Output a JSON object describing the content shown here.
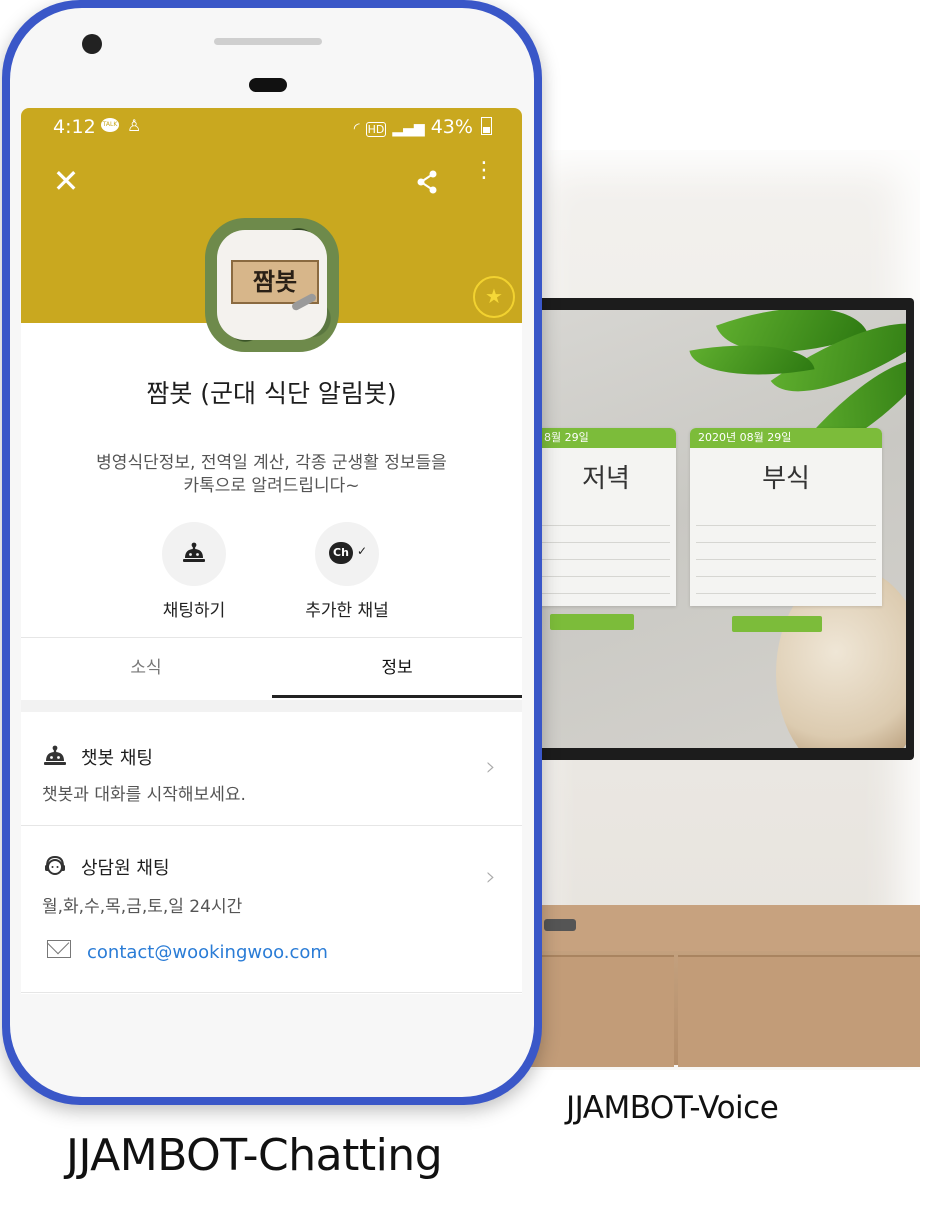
{
  "phone": {
    "status_bar": {
      "time": "4:12",
      "talk_badge": "TALK",
      "network": "HD",
      "battery": "43%"
    },
    "header": {
      "close_icon": "close-icon",
      "share_icon": "share-icon",
      "more_icon": "more-vert-icon",
      "hero_color": "#c9a81f"
    },
    "profile": {
      "avatar_text": "짬봇",
      "name": "짬봇 (군대 식단 알림봇)",
      "description_line1": "병영식단정보, 전역일 계산, 각종 군생활 정보들을",
      "description_line2": "카톡으로 알려드립니다~",
      "favorite_icon": "star-icon"
    },
    "actions": [
      {
        "label": "채팅하기",
        "icon": "chatbot-icon"
      },
      {
        "label": "추가한 채널",
        "icon": "channel-added-icon",
        "glyph": "Ch"
      }
    ],
    "tabs": [
      {
        "label": "소식",
        "active": false
      },
      {
        "label": "정보",
        "active": true
      }
    ],
    "info": {
      "chatbot_title": "챗봇 채팅",
      "chatbot_subtitle": "챗봇과 대화를 시작해보세요.",
      "agent_title": "상담원 채팅",
      "agent_hours": "월,화,수,목,금,토,일 24시간",
      "email": "contact@wookingwoo.com"
    },
    "accent_color": "#2a7cd6",
    "frame_color": "#3a57c8"
  },
  "tv": {
    "left_card": {
      "date": "8월 29일",
      "meal": "저녁"
    },
    "right_card": {
      "date": "2020년 08월 29일",
      "meal": "부식"
    },
    "card_accent": "#7cbc3a"
  },
  "captions": {
    "voice": "JJAMBOT-Voice",
    "chatting": "JJAMBOT-Chatting"
  }
}
